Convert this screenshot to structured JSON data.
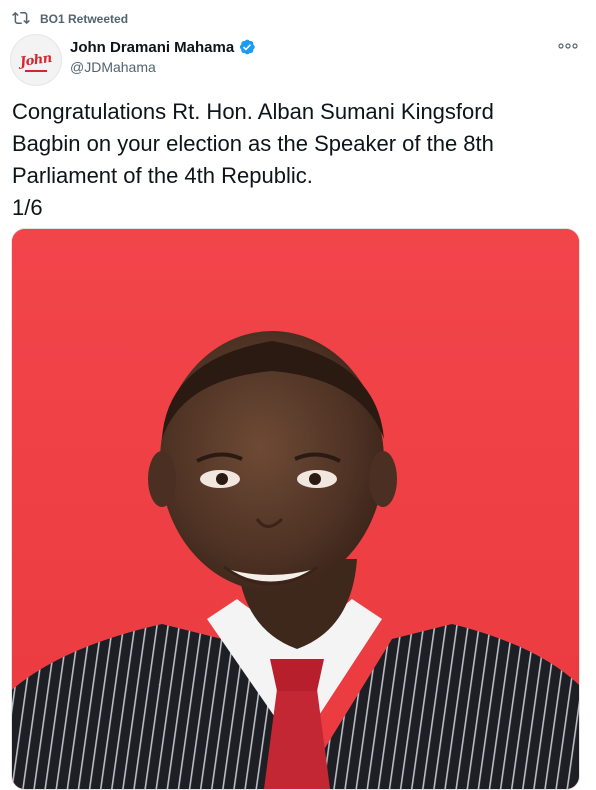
{
  "retweet": {
    "icon": "retweet-icon",
    "label": "BO1 Retweeted"
  },
  "author": {
    "avatar_icon": "campaign-logo-avatar",
    "avatar_text": "John",
    "display_name": "John Dramani Mahama",
    "verified_icon": "verified-badge-icon",
    "handle": "@JDMahama"
  },
  "tweet": {
    "lines": [
      "Congratulations Rt. Hon. Alban Sumani Kingsford",
      "Bagbin on your election as the Speaker of the 8th",
      "Parliament of the 4th Republic.",
      "1/6"
    ]
  },
  "media": {
    "subject": "portrait-photo",
    "background_color": "#f03e42"
  },
  "colors": {
    "text": "#0f1419",
    "secondary": "#536471",
    "verified": "#1d9bf0",
    "brand_red": "#d6252f"
  }
}
